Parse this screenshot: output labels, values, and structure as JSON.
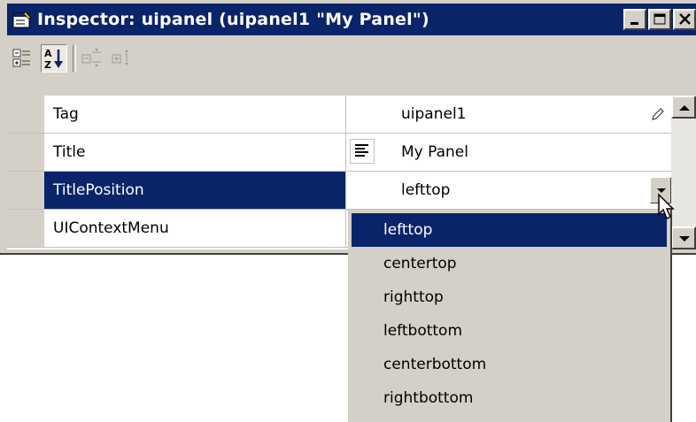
{
  "window": {
    "title": "Inspector:  uipanel (uipanel1 \"My Panel\")",
    "controls": [
      "minimize",
      "maximize",
      "close"
    ]
  },
  "toolbar": {
    "icons": [
      "categorized-view-icon",
      "alphabetical-sort-icon",
      "expand-all-icon",
      "collapse-all-icon"
    ],
    "active": "alphabetical-sort-icon"
  },
  "properties": [
    {
      "name": "Tag",
      "value": "uipanel1",
      "editor": "pencil"
    },
    {
      "name": "Title",
      "value": "My Panel",
      "editor": "text-align"
    },
    {
      "name": "TitlePosition",
      "value": "lefttop",
      "editor": "dropdown",
      "selected": true
    },
    {
      "name": "UIContextMenu",
      "value": "",
      "editor": "none"
    }
  ],
  "dropdown": {
    "options": [
      "lefttop",
      "centertop",
      "righttop",
      "leftbottom",
      "centerbottom",
      "rightbottom"
    ],
    "selected": "lefttop"
  },
  "colors": {
    "titlebar": "#0a246a",
    "selection": "#0a246a",
    "chrome": "#d4d0c8"
  }
}
